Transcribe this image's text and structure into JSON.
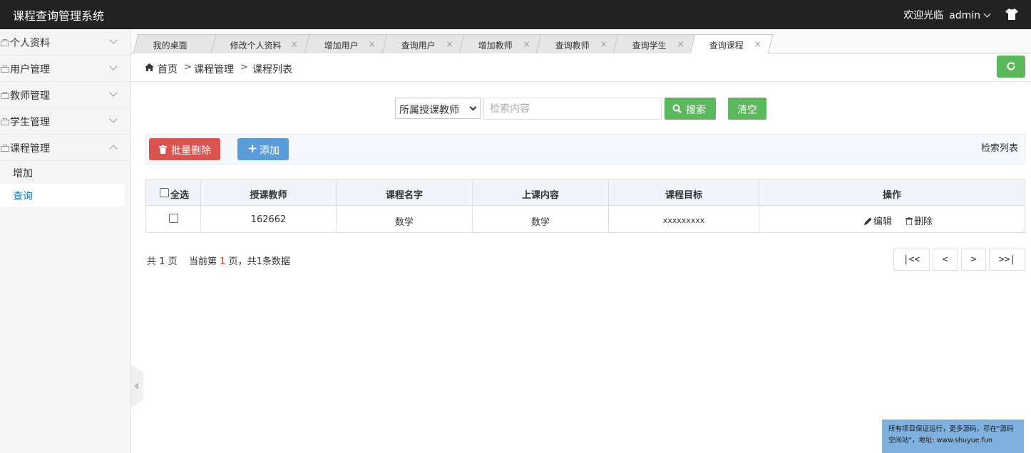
{
  "app": {
    "title": "课程查询管理系统"
  },
  "header": {
    "welcome": "欢迎光临",
    "username": "admin"
  },
  "sidebar": {
    "menus": [
      {
        "label": "个人资料",
        "expanded": false
      },
      {
        "label": "用户管理",
        "expanded": false
      },
      {
        "label": "教师管理",
        "expanded": false
      },
      {
        "label": "学生管理",
        "expanded": false
      },
      {
        "label": "课程管理",
        "expanded": true
      }
    ],
    "submenu": [
      {
        "label": "增加",
        "active": false
      },
      {
        "label": "查询",
        "active": true
      }
    ]
  },
  "tabs": [
    {
      "label": "我的桌面",
      "closable": false
    },
    {
      "label": "修改个人资料",
      "closable": true
    },
    {
      "label": "增加用户",
      "closable": true
    },
    {
      "label": "查询用户",
      "closable": true
    },
    {
      "label": "增加教师",
      "closable": true
    },
    {
      "label": "查询教师",
      "closable": true
    },
    {
      "label": "查询学生",
      "closable": true
    },
    {
      "label": "查询课程",
      "closable": true,
      "active": true
    }
  ],
  "tab_close_glyph": "×",
  "breadcrumb": {
    "home": "首页",
    "sep": ">",
    "level1": "课程管理",
    "level2": "课程列表"
  },
  "search": {
    "select_value": "所属授课教师",
    "placeholder": "检索内容",
    "search_label": "搜索",
    "clear_label": "清空"
  },
  "toolbar": {
    "batch_delete": "批量删除",
    "add": "添加",
    "list_title": "检索列表"
  },
  "table": {
    "select_all": "全选",
    "columns": [
      "授课教师",
      "课程名字",
      "上课内容",
      "课程目标",
      "操作"
    ],
    "rows": [
      {
        "teacher": "162662",
        "course_name": "数学",
        "content": "数学",
        "goal": "xxxxxxxxx"
      }
    ],
    "edit_label": "编辑",
    "delete_label": "删除"
  },
  "pagination": {
    "total_pages_prefix": "共",
    "total_pages": "1",
    "total_pages_suffix": "页",
    "current_prefix": "当前第",
    "current": "1",
    "current_suffix": "页，共1条数据",
    "first": "|<<",
    "prev": "<",
    "next": ">",
    "last": ">>|"
  },
  "promo": {
    "line1": "所有项目保证运行，更多源码，尽在\"源码",
    "line2": "空间站\"，地址: www.shuyue.fun"
  },
  "colors": {
    "header_bg": "#222222",
    "success": "#5cb85c",
    "danger": "#d9534f",
    "primary": "#5a9bd8",
    "active_link": "#1e7fb5"
  },
  "icons": [
    "shirt-icon",
    "bag-icon",
    "chevron-down-icon",
    "chevron-up-icon",
    "close-icon",
    "home-icon",
    "refresh-icon",
    "search-icon",
    "trash-icon",
    "plus-icon",
    "pencil-icon",
    "collapse-arrow-icon"
  ]
}
